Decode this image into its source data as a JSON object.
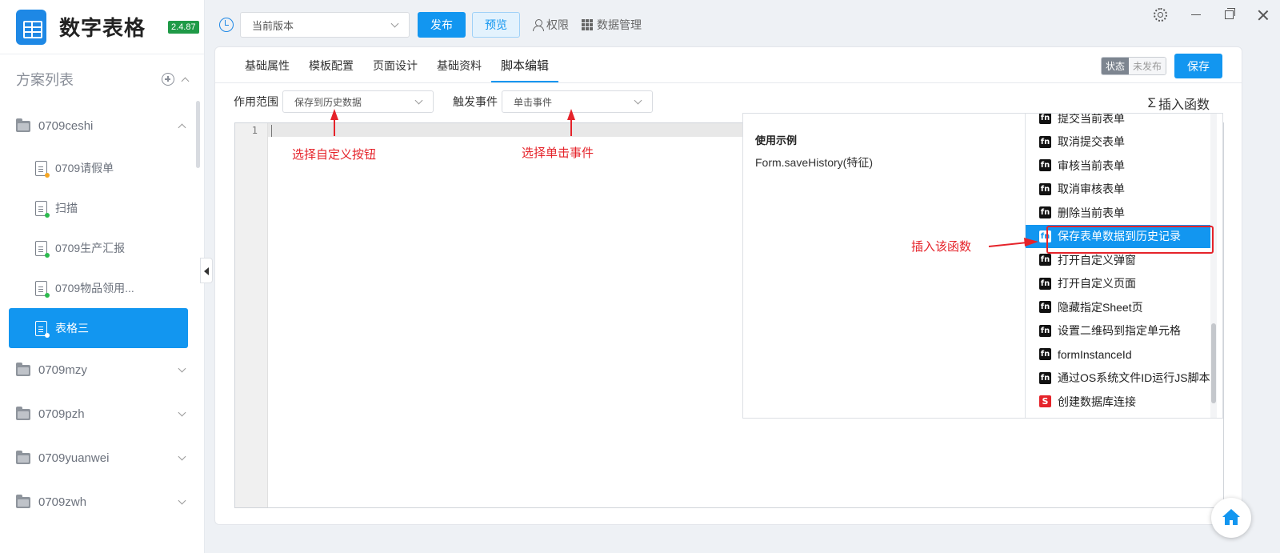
{
  "app": {
    "name": "数字表格",
    "version": "2.4.87"
  },
  "sidebar": {
    "title": "方案列表",
    "folders": [
      {
        "label": "0709ceshi",
        "expanded": true,
        "docs": [
          {
            "label": "0709请假单",
            "dot_color": "#f5a623"
          },
          {
            "label": "扫描",
            "dot_color": "#2dbb4e"
          },
          {
            "label": "0709生产汇报",
            "dot_color": "#2dbb4e"
          },
          {
            "label": "0709物品领用...",
            "dot_color": "#2dbb4e"
          },
          {
            "label": "表格三",
            "active": true
          }
        ]
      },
      {
        "label": "0709mzy"
      },
      {
        "label": "0709pzh"
      },
      {
        "label": "0709yuanwei"
      },
      {
        "label": "0709zwh"
      }
    ]
  },
  "topbar": {
    "version_select": "当前版本",
    "publish": "发布",
    "preview": "预览",
    "permissions": "权限",
    "data_management": "数据管理"
  },
  "tabs": [
    "基础属性",
    "模板配置",
    "页面设计",
    "基础资料",
    "脚本编辑"
  ],
  "active_tab": "脚本编辑",
  "status": {
    "label": "状态",
    "value": "未发布"
  },
  "save": "保存",
  "filters": {
    "scope_label": "作用范围",
    "scope_value": "保存到历史数据",
    "event_label": "触发事件",
    "event_value": "单击事件"
  },
  "insert_function": {
    "symbol": "Σ",
    "label": "插入函数"
  },
  "editor": {
    "line_number": "1"
  },
  "function_panel": {
    "example_title": "使用示例",
    "example_code": "Form.saveHistory(特征)",
    "functions": [
      {
        "badge": "fn",
        "label": "提交当前表单"
      },
      {
        "badge": "fn",
        "label": "取消提交表单"
      },
      {
        "badge": "fn",
        "label": "审核当前表单"
      },
      {
        "badge": "fn",
        "label": "取消审核表单"
      },
      {
        "badge": "fn",
        "label": "删除当前表单"
      },
      {
        "badge": "fn",
        "label": "保存表单数据到历史记录",
        "selected": true
      },
      {
        "badge": "fn",
        "label": "打开自定义弹窗"
      },
      {
        "badge": "fn",
        "label": "打开自定义页面"
      },
      {
        "badge": "fn",
        "label": "隐藏指定Sheet页"
      },
      {
        "badge": "fn",
        "label": "设置二维码到指定单元格"
      },
      {
        "badge": "fn",
        "label": "formInstanceId"
      },
      {
        "badge": "fn",
        "label": "通过OS系统文件ID运行JS脚本"
      },
      {
        "badge": "S",
        "label": "创建数据库连接"
      }
    ]
  },
  "annotations": {
    "scope": "选择自定义按钮",
    "event": "选择单击事件",
    "insert": "插入该函数",
    "color": "#e5232a"
  },
  "colors": {
    "primary": "#1296f0",
    "version_badge": "#1f9a47"
  }
}
